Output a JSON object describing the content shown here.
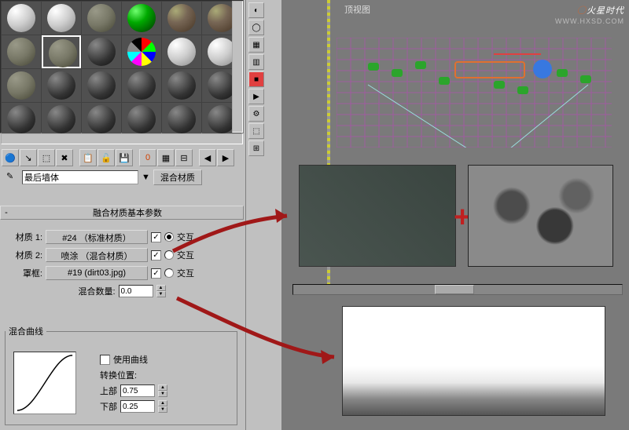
{
  "viewport": {
    "label": "顶视图"
  },
  "watermark": {
    "brand": "火星时代",
    "url": "WWW.HXSD.COM"
  },
  "material_name": "最后墙体",
  "material_type_btn": "混合材质",
  "rollout_title": "融合材质基本参数",
  "param_rows": {
    "mat1": {
      "label": "材质 1:",
      "slot": "#24 （标准材质）",
      "radio_label": "交互"
    },
    "mat2": {
      "label": "材质 2:",
      "slot": "喷涂 （混合材质）",
      "radio_label": "交互"
    },
    "mask": {
      "label": "罩框:",
      "slot": "#19 (dirt03.jpg)",
      "radio_label": "交互"
    }
  },
  "mix_amount": {
    "label": "混合数量:",
    "value": "0.0"
  },
  "curve": {
    "group_title": "混合曲线",
    "use_curve": "使用曲线",
    "transition": "转换位置:",
    "upper_label": "上部",
    "upper_value": "0.75",
    "lower_label": "下部",
    "lower_value": "0.25"
  },
  "plus": "+",
  "icons": {
    "dropper": "✎"
  }
}
